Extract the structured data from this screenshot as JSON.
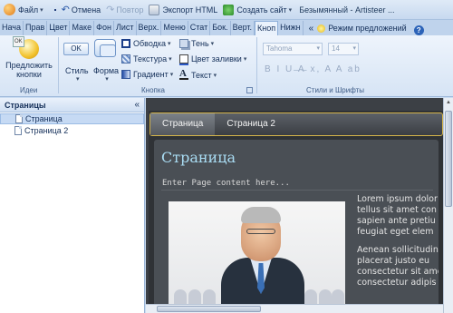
{
  "quick_access": {
    "file": "Файл",
    "undo": "Отмена",
    "redo": "Повтор",
    "export_html": "Экспорт HTML",
    "create_site": "Создать сайт",
    "window_title": "Безымянный - Artisteer ..."
  },
  "ribbon_tabs": [
    "Нача",
    "Прав",
    "Цвет",
    "Маке",
    "Фон",
    "Лист",
    "Верх.",
    "Меню",
    "Стат",
    "Бок. ",
    "Верт.",
    "Кноп",
    "Нижн"
  ],
  "active_tab_index": 11,
  "toolbar_right": {
    "chevron": "«",
    "preview_mode": "Режим предложений",
    "help": "?"
  },
  "ribbon": {
    "ideas_group": {
      "suggest_label": "Предложить кнопки",
      "ok_badge": "OK",
      "group_label": "Идеи"
    },
    "button_group": {
      "style_preview": "OK",
      "style_label": "Стиль",
      "form_label": "Форма",
      "outline": "Обводка",
      "texture": "Текстура",
      "gradient": "Градиент",
      "shadow": "Тень",
      "fill_color": "Цвет заливки",
      "text": "Текст",
      "group_label": "Кнопка"
    },
    "font_group": {
      "font_name": "Tahoma",
      "font_size": "14",
      "format_icons": "B I U ̶A̶ x, A A ab",
      "group_label": "Стили и Шрифты"
    }
  },
  "left_panel": {
    "title": "Страницы",
    "collapse": "«",
    "pages": [
      "Страница",
      "Страница 2"
    ],
    "selected_index": 0
  },
  "preview": {
    "menu_items": [
      "Страница",
      "Страница 2"
    ],
    "active_menu_index": 0,
    "heading": "Страница",
    "enter_text": "Enter Page content here...",
    "lorem_1": [
      "Lorem ipsum dolor",
      "tellus sit amet con",
      "sapien ante pretiu",
      "feugiat eget elem"
    ],
    "lorem_2": [
      "Aenean sollicitudin",
      "placerat justo eu",
      "consectetur sit ame",
      "consectetur adipis"
    ]
  },
  "colors": {
    "accent_gold": "#d4b44a",
    "heading_blue": "#a9dcf3",
    "ribbon_bg": "#d6e4f5"
  }
}
